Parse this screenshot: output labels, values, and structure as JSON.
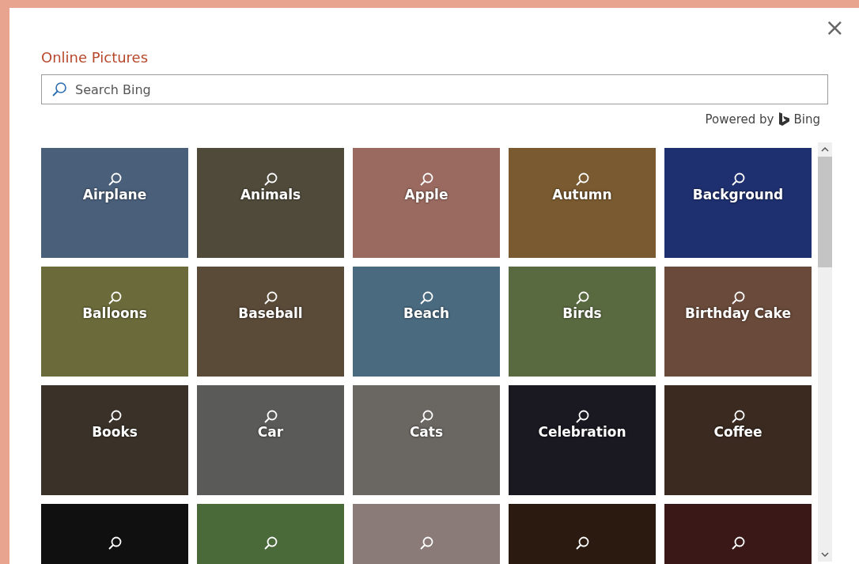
{
  "dialog": {
    "title": "Online Pictures",
    "close": "×"
  },
  "search": {
    "placeholder": "Search Bing"
  },
  "powered_by": {
    "text": "Powered by",
    "brand": "Bing"
  },
  "tiles": [
    {
      "label": "Airplane"
    },
    {
      "label": "Animals"
    },
    {
      "label": "Apple"
    },
    {
      "label": "Autumn"
    },
    {
      "label": "Background"
    },
    {
      "label": "Balloons"
    },
    {
      "label": "Baseball"
    },
    {
      "label": "Beach"
    },
    {
      "label": "Birds"
    },
    {
      "label": "Birthday Cake"
    },
    {
      "label": "Books"
    },
    {
      "label": "Car"
    },
    {
      "label": "Cats"
    },
    {
      "label": "Celebration"
    },
    {
      "label": "Coffee"
    },
    {
      "kind": "cut_off"
    },
    {
      "kind": "cut_off"
    },
    {
      "kind": "cut_off"
    },
    {
      "kind": "cut_off"
    },
    {
      "kind": "cut_off"
    }
  ]
}
